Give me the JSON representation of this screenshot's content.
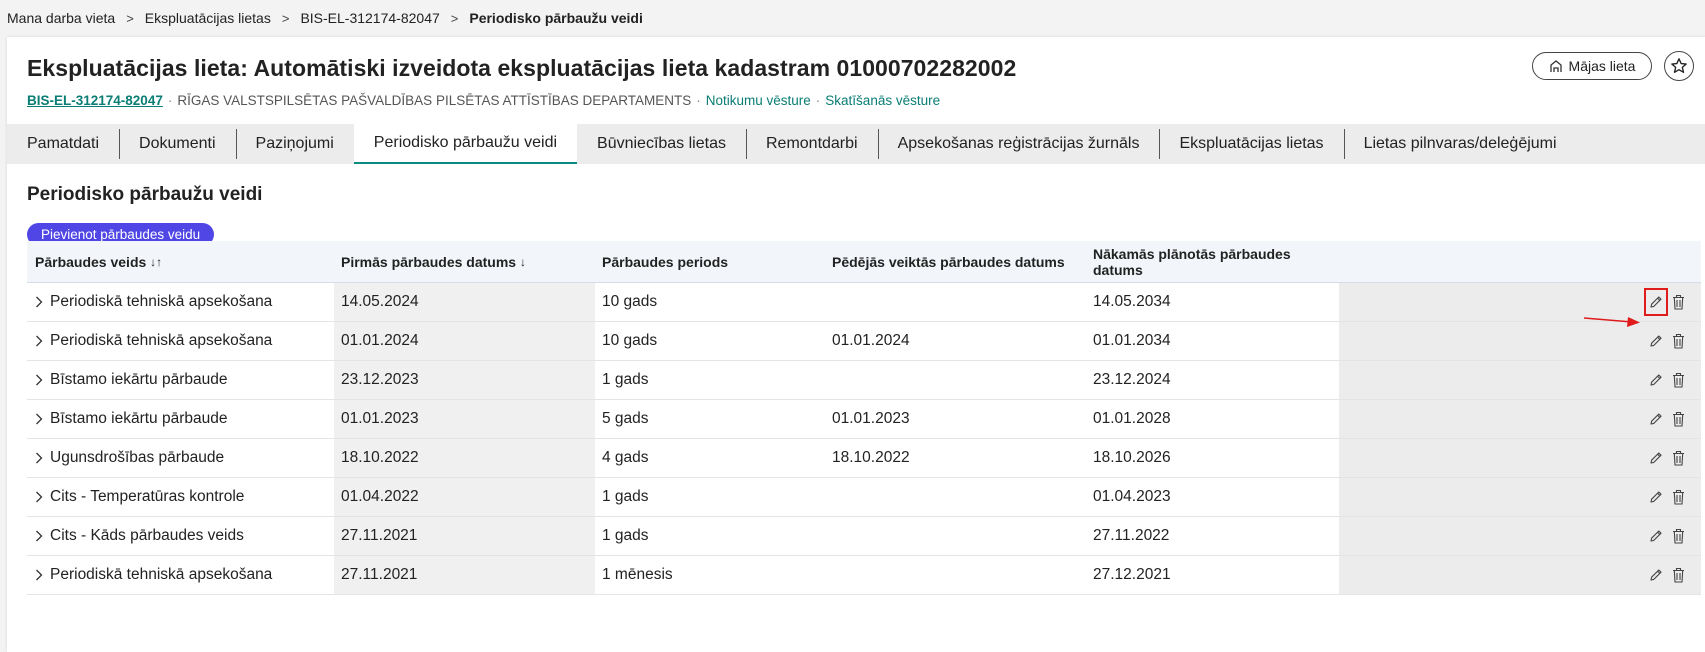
{
  "breadcrumb": {
    "items": [
      "Mana darba vieta",
      "Ekspluatācijas lietas",
      "BIS-EL-312174-82047"
    ],
    "current": "Periodisko pārbaužu veidi"
  },
  "header": {
    "title": "Ekspluatācijas lieta: Automātiski izveidota ekspluatācijas lieta kadastram 01000702282002",
    "code": "BIS-EL-312174-82047",
    "department": "RĪGAS VALSTSPILSĒTAS PAŠVALDĪBAS PILSĒTAS ATTĪSTĪBAS DEPARTAMENTS",
    "history_link": "Notikumu vēsture",
    "views_link": "Skatīšanās vēsture",
    "house_button": "Mājas lieta"
  },
  "tabs": [
    {
      "label": "Pamatdati"
    },
    {
      "label": "Dokumenti"
    },
    {
      "label": "Paziņojumi"
    },
    {
      "label": "Periodisko pārbaužu veidi",
      "active": true
    },
    {
      "label": "Būvniecības lietas"
    },
    {
      "label": "Remontdarbi"
    },
    {
      "label": "Apsekošanas reģistrācijas žurnāls"
    },
    {
      "label": "Ekspluatācijas lietas"
    },
    {
      "label": "Lietas pilnvaras/deleģējumi"
    }
  ],
  "section": {
    "title": "Periodisko pārbaužu veidi",
    "add_button": "Pievienot pārbaudes veidu"
  },
  "table": {
    "columns": [
      "Pārbaudes veids",
      "Pirmās pārbaudes datums",
      "Pārbaudes periods",
      "Pēdējās veiktās pārbaudes datums",
      "Nākamās plānotās pārbaudes datums"
    ],
    "sort_icons": {
      "col0": "↓↑",
      "col1": "↓"
    },
    "rows": [
      [
        "Periodiskā tehniskā apsekošana",
        "14.05.2024",
        "10 gads",
        "",
        "14.05.2034"
      ],
      [
        "Periodiskā tehniskā apsekošana",
        "01.01.2024",
        "10 gads",
        "01.01.2024",
        "01.01.2034"
      ],
      [
        "Bīstamo iekārtu pārbaude",
        "23.12.2023",
        "1 gads",
        "",
        "23.12.2024"
      ],
      [
        "Bīstamo iekārtu pārbaude",
        "01.01.2023",
        "5 gads",
        "01.01.2023",
        "01.01.2028"
      ],
      [
        "Ugunsdrošības pārbaude",
        "18.10.2022",
        "4 gads",
        "18.10.2022",
        "18.10.2026"
      ],
      [
        "Cits - Temperatūras kontrole",
        "01.04.2022",
        "1 gads",
        "",
        "01.04.2023"
      ],
      [
        "Cits - Kāds pārbaudes veids",
        "27.11.2021",
        "1 gads",
        "",
        "27.11.2022"
      ],
      [
        "Periodiskā tehniskā apsekošana",
        "27.11.2021",
        "1 mēnesis",
        "",
        "27.12.2021"
      ]
    ]
  },
  "colors": {
    "accent": "#0a8a80",
    "button": "#4f46e5",
    "highlight": "#e01b1b"
  },
  "icons": {
    "row_expand": "chevron-right-icon",
    "edit": "pencil-icon",
    "delete": "trash-icon",
    "house": "house-icon",
    "favorite": "star-icon"
  }
}
